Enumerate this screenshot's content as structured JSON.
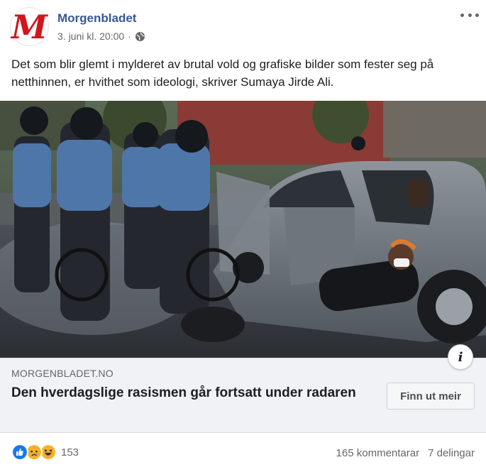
{
  "header": {
    "page_name": "Morgenbladet",
    "timestamp": "3. juni kl. 20:00",
    "separator": "·",
    "avatar_letter": "M",
    "avatar_icon": "morgenbladet-logo",
    "privacy_icon": "globe-icon",
    "more_icon": "more-horizontal-icon"
  },
  "post": {
    "text": "Det som blir glemt i mylderet av brutal vold og grafiske bilder som fester seg på netthinnen, er hvithet som ideologi, skriver Sumaya Jirde Ali."
  },
  "link": {
    "domain": "MORGENBLADET.NO",
    "title": "Den hverdagslige rasismen går fortsatt under radaren",
    "cta_label": "Finn ut meir",
    "info_label": "i"
  },
  "footer": {
    "reaction_icons": [
      "like-icon",
      "sad-icon",
      "haha-icon"
    ],
    "reaction_count": "153",
    "comments": "165 kommentarar",
    "shares": "7 delingar"
  },
  "colors": {
    "brand_red": "#d0161d",
    "link_blue": "#385898",
    "like_blue": "#1877f2",
    "emoji_yellow": "#f7b125"
  }
}
